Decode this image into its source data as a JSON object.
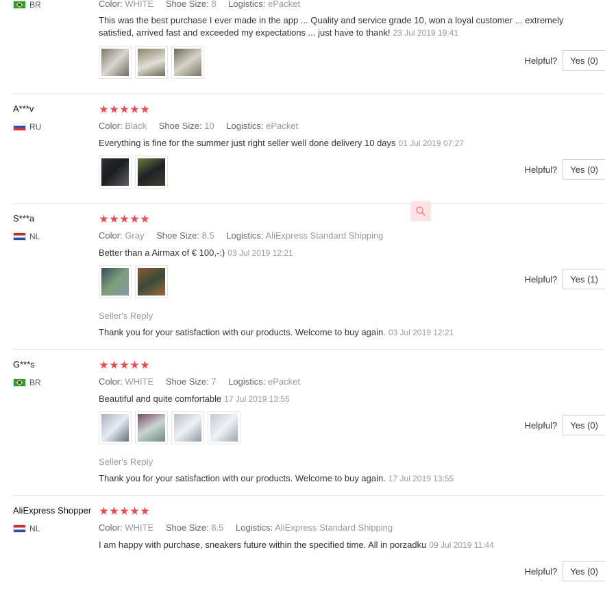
{
  "helpful_label": "Helpful?",
  "seller_reply_label": "Seller's Reply",
  "labels": {
    "color": "Color:",
    "shoe_size": "Shoe Size:",
    "logistics": "Logistics:"
  },
  "colors": {
    "star": "#f5474f",
    "date": "#999999",
    "separator": "#e6e6e6"
  },
  "reviews": [
    {
      "name": "",
      "country": "BR",
      "color": "WHITE",
      "shoe_size": "8",
      "logistics": "ePacket",
      "text": "This was the best purchase I ever made in the app ... Quality and service grade 10, won a loyal customer ... extremely satisfied, arrived fast and exceeded my expectations ... just have to thank!",
      "date": "23 Jul 2019 19:41",
      "yes": "Yes (0)"
    },
    {
      "name": "A***v",
      "country": "RU",
      "color": "Black",
      "shoe_size": "10",
      "logistics": "ePacket",
      "text": "Everything is fine for the summer just right seller well done delivery 10 days",
      "date": "01 Jul 2019 07:27",
      "yes": "Yes (0)"
    },
    {
      "name": "S***a",
      "country": "NL",
      "color": "Gray",
      "shoe_size": "8.5",
      "logistics": "AliExpress Standard Shipping",
      "text": "Better than a Airmax of € 100,-:)",
      "date": "03 Jul 2019 12:21",
      "yes": "Yes (1)",
      "reply": "Thank you for your satisfaction with our products. Welcome to buy again.",
      "reply_date": "03 Jul 2019 12:21"
    },
    {
      "name": "G***s",
      "country": "BR",
      "color": "WHITE",
      "shoe_size": "7",
      "logistics": "ePacket",
      "text": "Beautiful and quite comfortable",
      "date": "17 Jul 2019 13:55",
      "yes": "Yes (0)",
      "reply": "Thank you for your satisfaction with our products. Welcome to buy again.",
      "reply_date": "17 Jul 2019 13:55"
    },
    {
      "name": "AliExpress Shopper",
      "country": "NL",
      "color": "WHITE",
      "shoe_size": "8.5",
      "logistics": "AliExpress Standard Shipping",
      "text": "I am happy with purchase, sneakers future within the specified time. All in porzadku",
      "date": "09 Jul 2019 11:44",
      "yes": "Yes (0)"
    }
  ]
}
